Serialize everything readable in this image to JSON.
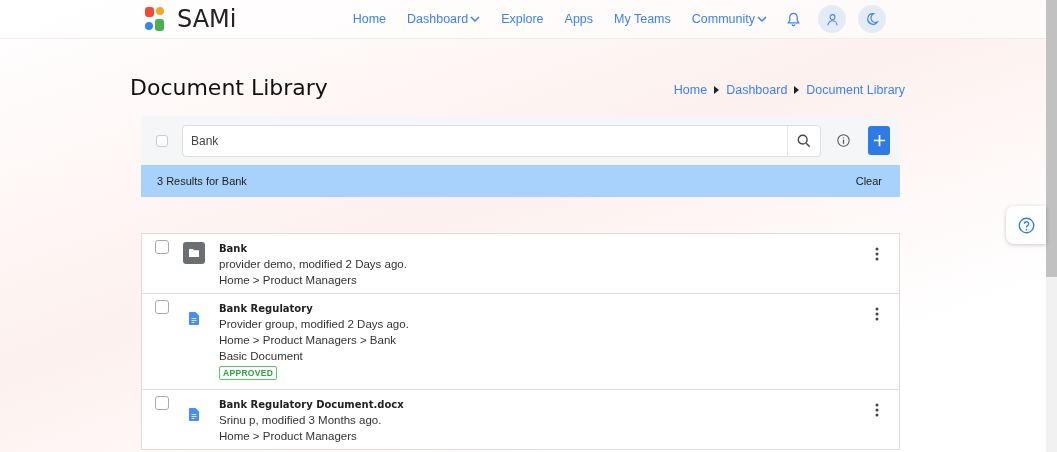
{
  "header": {
    "brand": "SAMi",
    "nav": [
      {
        "label": "Home",
        "dropdown": false
      },
      {
        "label": "Dashboard",
        "dropdown": true
      },
      {
        "label": "Explore",
        "dropdown": false
      },
      {
        "label": "Apps",
        "dropdown": false
      },
      {
        "label": "My Teams",
        "dropdown": false
      },
      {
        "label": "Community",
        "dropdown": true
      }
    ]
  },
  "page": {
    "title": "Document Library",
    "breadcrumb": [
      "Home",
      "Dashboard",
      "Document Library"
    ]
  },
  "toolbar": {
    "select_all_checked": false,
    "search_value": "Bank"
  },
  "results": {
    "summary": "3 Results for Bank",
    "clear": "Clear"
  },
  "documents": [
    {
      "kind": "folder",
      "checked": false,
      "title": "Bank",
      "lines": [
        "provider demo, modified 2 Days ago.",
        "Home > Product Managers"
      ]
    },
    {
      "kind": "document",
      "checked": false,
      "title": "Bank Regulatory",
      "lines": [
        "Provider group, modified 2 Days ago.",
        "Home > Product Managers > Bank",
        "Basic Document"
      ],
      "status": "APPROVED"
    },
    {
      "kind": "document",
      "checked": false,
      "title": "Bank Regulatory Document.docx",
      "lines": [
        "Srinu p, modified 3 Months ago.",
        "Home > Product Managers"
      ]
    }
  ]
}
